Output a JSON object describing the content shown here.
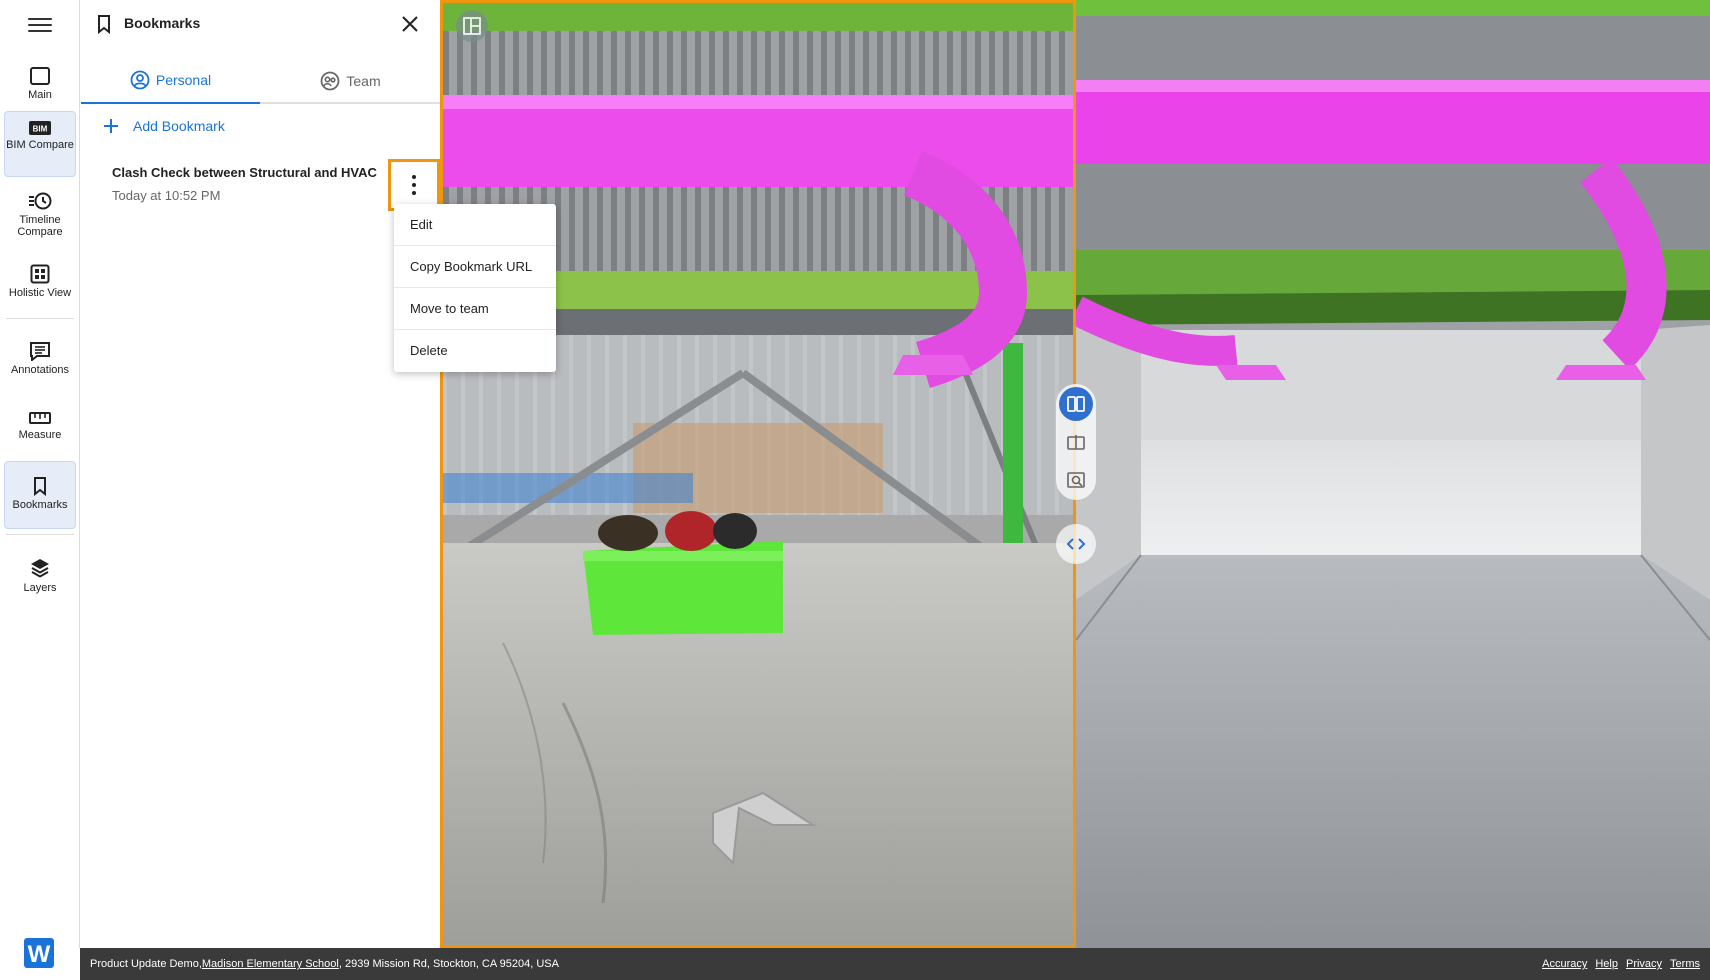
{
  "rail": {
    "items": [
      {
        "label": "Main",
        "icon": "square-icon"
      },
      {
        "label": "BIM Compare",
        "icon": "bim-icon",
        "badge": "BIM"
      },
      {
        "label": "Timeline Compare",
        "icon": "clock-icon"
      },
      {
        "label": "Holistic View",
        "icon": "grid-icon"
      },
      {
        "label": "Annotations",
        "icon": "annotation-icon"
      },
      {
        "label": "Measure",
        "icon": "ruler-icon"
      },
      {
        "label": "Bookmarks",
        "icon": "bookmark-icon"
      },
      {
        "label": "Layers",
        "icon": "layers-icon"
      }
    ],
    "logo_letter": "W"
  },
  "panel": {
    "title": "Bookmarks",
    "tabs": [
      {
        "label": "Personal"
      },
      {
        "label": "Team"
      }
    ],
    "add_label": "Add Bookmark",
    "bookmark": {
      "title": "Clash Check between Structural and HVAC",
      "time": "Today at 10:52 PM"
    },
    "menu": [
      "Edit",
      "Copy Bookmark URL",
      "Move to team",
      "Delete"
    ]
  },
  "footer": {
    "project": "Product Update Demo, ",
    "site_link": "Madison Elementary School",
    "address": ", 2939 Mission Rd, Stockton, CA 95204, USA",
    "links": [
      "Accuracy",
      "Help",
      "Privacy",
      "Terms"
    ]
  },
  "colors": {
    "accent": "#1a73d9",
    "highlight": "#f0960e",
    "hvac_duct": "#e64ee6",
    "structure_green": "#7fc23a",
    "footer_bg": "#3a3a3a"
  }
}
